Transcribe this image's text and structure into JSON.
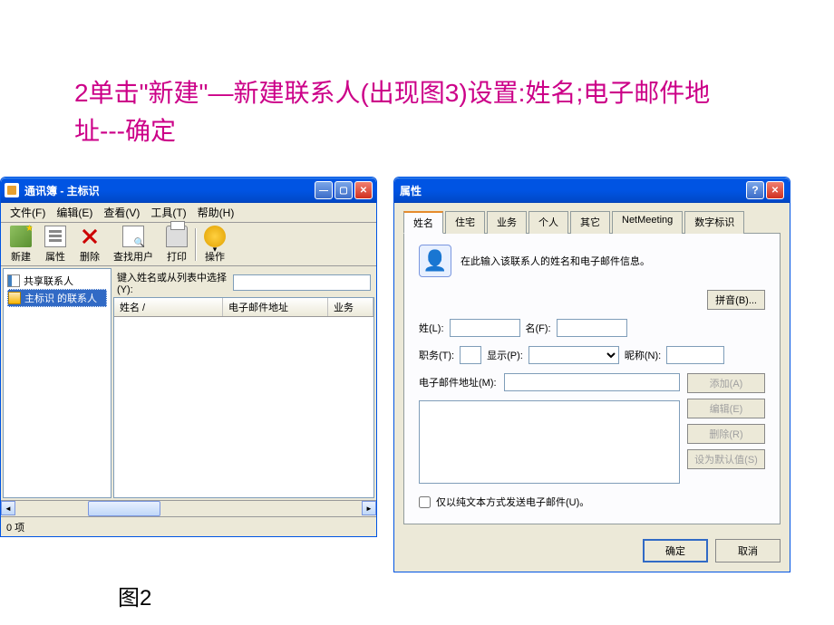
{
  "instruction_text": "2单击\"新建\"—新建联系人(出现图3)设置:姓名;电子邮件地址---确定",
  "caption_text": "图2",
  "ab": {
    "title": "通讯簿 - 主标识",
    "menu": {
      "file": "文件(F)",
      "edit": "编辑(E)",
      "view": "查看(V)",
      "tools": "工具(T)",
      "help": "帮助(H)"
    },
    "toolbar": {
      "new": "新建",
      "prop": "属性",
      "del": "删除",
      "find": "查找用户",
      "print": "打印",
      "action": "操作"
    },
    "sidebar": {
      "shared": "共享联系人",
      "main": "主标识 的联系人"
    },
    "search_label": "键入姓名或从列表中选择(Y):",
    "search_value": "",
    "cols": {
      "name": "姓名  /",
      "email": "电子邮件地址",
      "biz": "业务"
    },
    "status": "0 项"
  },
  "prop": {
    "title": "属性",
    "tabs": {
      "name": "姓名",
      "home": "住宅",
      "biz": "业务",
      "personal": "个人",
      "other": "其它",
      "netmeeting": "NetMeeting",
      "digital": "数字标识"
    },
    "info": "在此输入该联系人的姓名和电子邮件信息。",
    "pinyin_btn": "拼音(B)...",
    "labels": {
      "last": "姓(L):",
      "first": "名(F):",
      "title": "职务(T):",
      "display": "显示(P):",
      "nick": "昵称(N):",
      "email": "电子邮件地址(M):"
    },
    "values": {
      "last": "",
      "first": "",
      "title": "",
      "display": "",
      "nick": "",
      "email": ""
    },
    "side": {
      "add": "添加(A)",
      "edit": "编辑(E)",
      "remove": "删除(R)",
      "default": "设为默认值(S)"
    },
    "plaintext": "仅以纯文本方式发送电子邮件(U)。",
    "ok": "确定",
    "cancel": "取消"
  }
}
